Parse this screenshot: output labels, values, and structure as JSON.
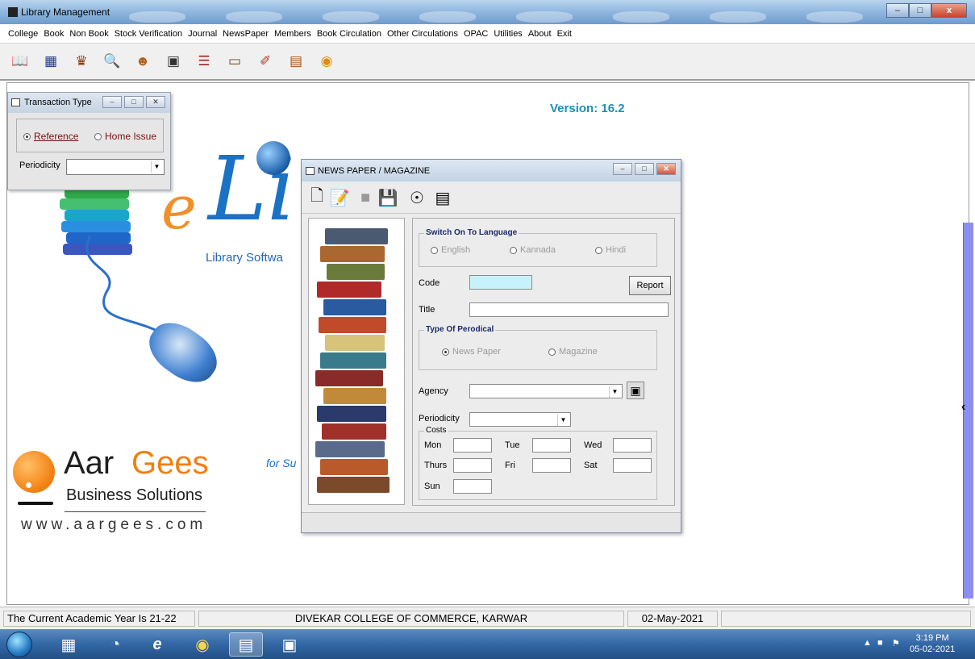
{
  "window": {
    "title": "Library Management",
    "buttons": [
      "–",
      "□",
      "x"
    ]
  },
  "menu": [
    "College",
    "Book",
    "Non Book",
    "Stock Verification",
    "Journal",
    "NewsPaper",
    "Members",
    "Book Circulation",
    "Other Circulations",
    "OPAC",
    "Utilities",
    "About",
    "Exit"
  ],
  "toolbar_icons": [
    "book-icon",
    "calendar-icon",
    "reader-icon",
    "search-computer-icon",
    "person-icon",
    "id-card-icon",
    "bookshelf-icon",
    "notebook-icon",
    "pencil-icon",
    "exit-door-icon",
    "cd-icon"
  ],
  "version": "Version: 16.2",
  "logo": {
    "product": "Library Softwa",
    "tagline_partial": "for Su",
    "company_part1": "Aar",
    "company_part2": "Gees",
    "company_sub": "Business Solutions",
    "url": "www.aargees.com"
  },
  "transaction_window": {
    "title": "Transaction Type",
    "radio_reference": "Reference",
    "radio_home": "Home Issue",
    "periodicity_label": "Periodicity",
    "periodicity_value": ""
  },
  "newspaper_window": {
    "title": "NEWS PAPER / MAGAZINE",
    "language_legend": "Switch On To Language",
    "lang_english": "English",
    "lang_kannada": "Kannada",
    "lang_hindi": "Hindi",
    "code_label": "Code",
    "report_button": "Report",
    "title_label": "Title",
    "periodical_legend": "Type Of Perodical",
    "type_newspaper": "News Paper",
    "type_magazine": "Magazine",
    "agency_label": "Agency",
    "periodicity_label": "Periodicity",
    "costs_legend": "Costs",
    "days": {
      "mon": "Mon",
      "tue": "Tue",
      "wed": "Wed",
      "thurs": "Thurs",
      "fri": "Fri",
      "sat": "Sat",
      "sun": "Sun"
    }
  },
  "status": {
    "academic_year": "The Current Academic Year Is 21-22",
    "college": "DIVEKAR COLLEGE OF COMMERCE, KARWAR",
    "date": "02-May-2021"
  },
  "taskbar": {
    "time": "3:19 PM",
    "date": "05-02-2021"
  },
  "colors": {
    "version": "#1d8fb0",
    "accent_orange": "#f27e10",
    "brand_blue": "#1a72c4",
    "code_field": "#c8f2fb"
  }
}
